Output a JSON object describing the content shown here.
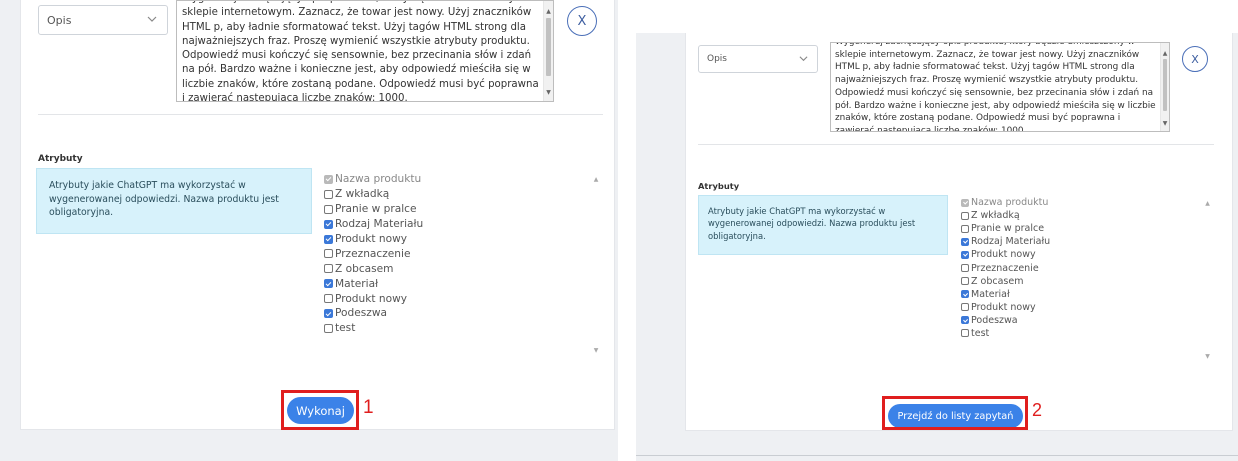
{
  "opis_select": {
    "value": "Opis"
  },
  "close_button": {
    "label": "X"
  },
  "prompt_text_left": "Wygeneruj zachęcający opis produktu, który będzie umieszczony w sklepie internetowym. Zaznacz, że towar jest nowy. Użyj znaczników HTML p, aby ładnie sformatować tekst. Użyj tagów HTML strong dla najważniejszych fraz. Proszę wymienić wszystkie atrybuty produktu. Odpowiedź musi kończyć się sensownie, bez przecinania słów i zdań na pół. Bardzo ważne i konieczne jest, aby odpowiedź mieściła się w liczbie znaków, które zostaną podane. Odpowiedź musi być poprawna i zawierać następującą liczbę znaków: 1000.",
  "prompt_text_right": "Wygeneruj zachęcający opis produktu, który będzie umieszczony w sklepie internetowym. Zaznacz, że towar jest nowy. Użyj znaczników HTML p, aby ładnie sformatować tekst. Użyj tagów HTML strong dla najważniejszych fraz. Proszę wymienić wszystkie atrybuty produktu. Odpowiedź musi kończyć się sensownie, bez przecinania słów i zdań na pół. Bardzo ważne i konieczne jest, aby odpowiedź mieściła się w liczbie znaków, które zostaną podane. Odpowiedź musi być poprawna i zawierać następującą liczbę znaków: 1000.",
  "attributes": {
    "label": "Atrybuty",
    "info": "Atrybuty jakie ChatGPT ma wykorzystać w wygenerowanej odpowiedzi. Nazwa produktu jest obligatoryjna.",
    "items": [
      {
        "label": "Nazwa produktu",
        "state": "disabled-checked"
      },
      {
        "label": "Z wkładką",
        "state": "unchecked"
      },
      {
        "label": "Pranie w pralce",
        "state": "unchecked"
      },
      {
        "label": "Rodzaj Materiału",
        "state": "checked"
      },
      {
        "label": "Produkt nowy",
        "state": "checked"
      },
      {
        "label": "Przeznaczenie",
        "state": "unchecked"
      },
      {
        "label": "Z obcasem",
        "state": "unchecked"
      },
      {
        "label": "Materiał",
        "state": "checked"
      },
      {
        "label": "Produkt nowy",
        "state": "unchecked"
      },
      {
        "label": "Podeszwa",
        "state": "checked"
      },
      {
        "label": "test",
        "state": "unchecked"
      }
    ]
  },
  "left_action": {
    "label": "Wykonaj",
    "annotation": "1"
  },
  "right_action": {
    "label": "Przejdź do listy zapytań",
    "annotation": "2"
  },
  "colors": {
    "accent": "#3b82e8",
    "highlight": "#e01e1e",
    "info_bg": "#d7f2fb"
  },
  "icons": {
    "select": "chevron-down-icon",
    "close": "close-icon",
    "checkbox": "checkbox-icon"
  }
}
